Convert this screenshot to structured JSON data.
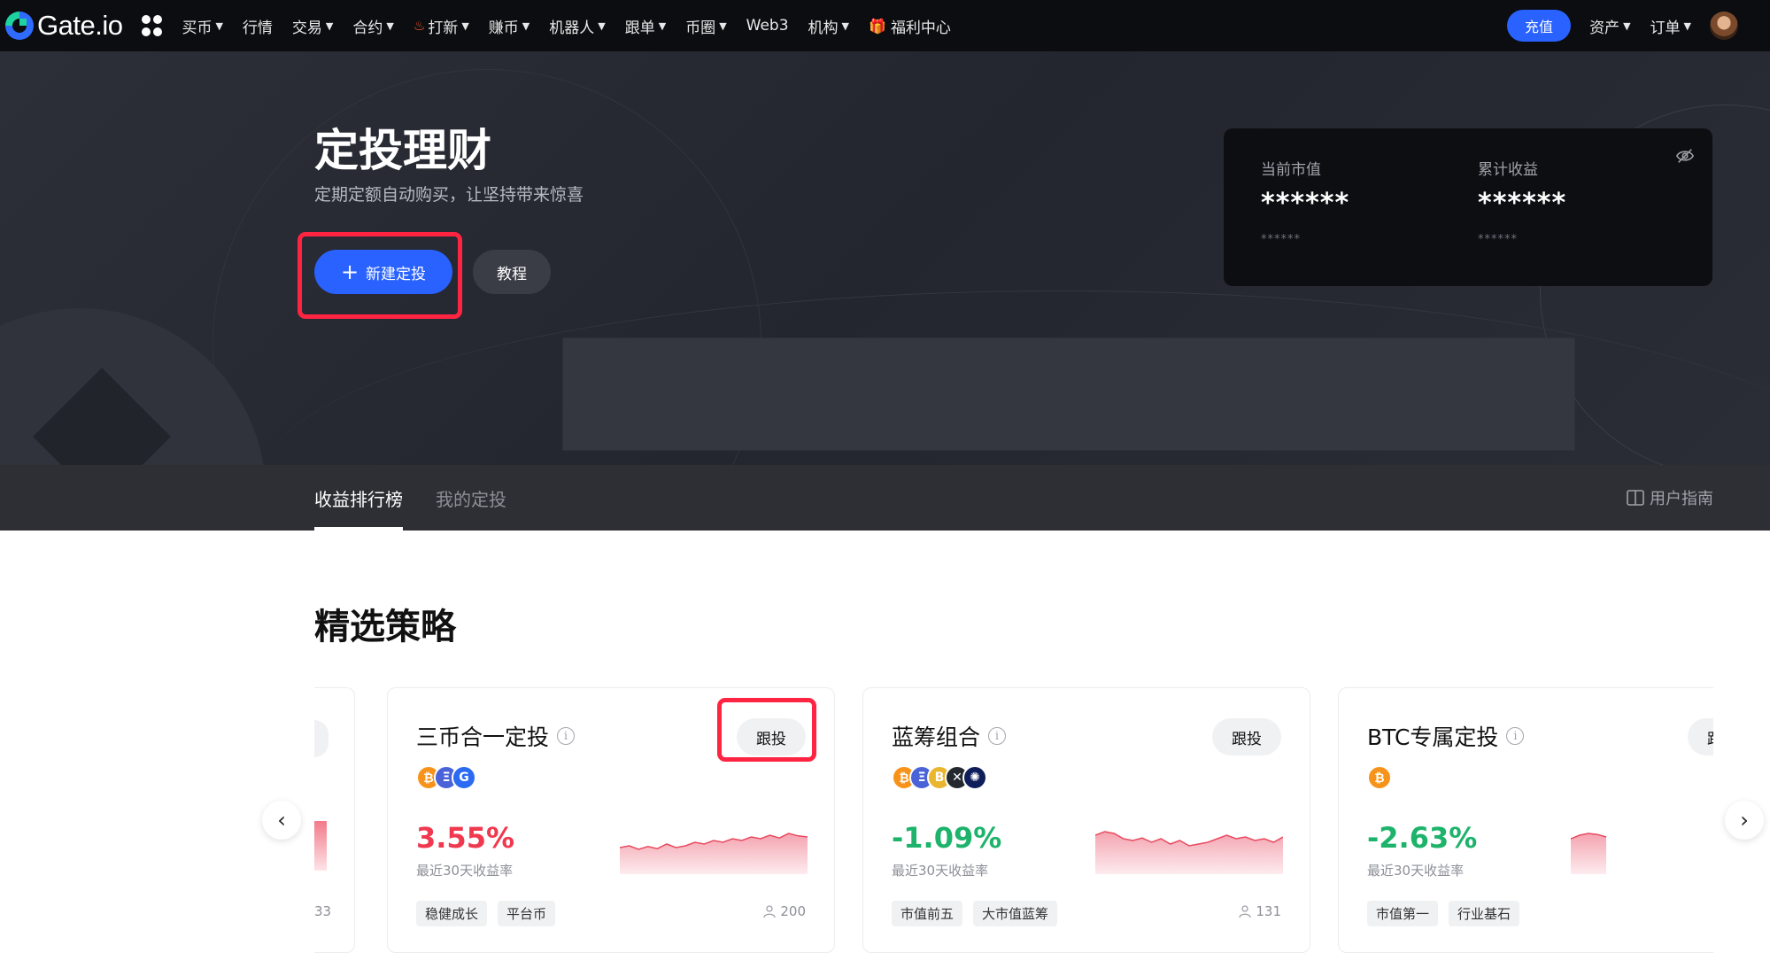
{
  "nav": {
    "brand": "Gate.io",
    "items": [
      {
        "label": "买币",
        "caret": true
      },
      {
        "label": "行情",
        "caret": false
      },
      {
        "label": "交易",
        "caret": true
      },
      {
        "label": "合约",
        "caret": true
      },
      {
        "label": "打新",
        "caret": true,
        "icon": "fire-icon"
      },
      {
        "label": "赚币",
        "caret": true
      },
      {
        "label": "机器人",
        "caret": true
      },
      {
        "label": "跟单",
        "caret": true
      },
      {
        "label": "币圈",
        "caret": true
      },
      {
        "label": "Web3",
        "caret": false
      },
      {
        "label": "机构",
        "caret": true
      },
      {
        "label": "福利中心",
        "caret": false,
        "icon": "gift-icon"
      }
    ],
    "deposit": "充值",
    "assets": "资产",
    "orders": "订单"
  },
  "hero": {
    "title": "定投理财",
    "subtitle": "定期定额自动购买，让坚持带来惊喜",
    "new_button": "新建定投",
    "tutorial_button": "教程",
    "asset_card": {
      "market_value_label": "当前市值",
      "market_value": "******",
      "market_value_sub": "******",
      "total_profit_label": "累计收益",
      "total_profit": "******",
      "total_profit_sub": "******"
    }
  },
  "tabs": {
    "ranking": "收益排行榜",
    "mine": "我的定投",
    "guide": "用户指南"
  },
  "section": {
    "title": "精选策略"
  },
  "left_stub": {
    "followers": "33"
  },
  "cards": [
    {
      "title": "三币合一定投",
      "follow": "跟投",
      "coins": [
        "btc",
        "eth",
        "gt"
      ],
      "yield": "3.55%",
      "yield_color": "#f0384e",
      "yield_label": "最近30天收益率",
      "tags": [
        "稳健成长",
        "平台币"
      ],
      "followers": "200",
      "spark": [
        0.55,
        0.5,
        0.6,
        0.52,
        0.58,
        0.45,
        0.55,
        0.5,
        0.4,
        0.45,
        0.35,
        0.4,
        0.3,
        0.35,
        0.25,
        0.3,
        0.2,
        0.28,
        0.15,
        0.22,
        0.25
      ]
    },
    {
      "title": "蓝筹组合",
      "follow": "跟投",
      "coins": [
        "btc",
        "eth",
        "bnb",
        "xrp",
        "ada"
      ],
      "yield": "-1.09%",
      "yield_color": "#1db36b",
      "yield_label": "最近30天收益率",
      "tags": [
        "市值前五",
        "大市值蓝筹"
      ],
      "followers": "131",
      "spark": [
        0.2,
        0.1,
        0.15,
        0.3,
        0.35,
        0.28,
        0.4,
        0.3,
        0.45,
        0.35,
        0.5,
        0.45,
        0.4,
        0.3,
        0.2,
        0.3,
        0.25,
        0.35,
        0.3,
        0.4,
        0.25
      ]
    },
    {
      "title": "BTC专属定投",
      "follow": "跟投",
      "coins": [
        "btc"
      ],
      "yield": "-2.63%",
      "yield_color": "#1db36b",
      "yield_label": "最近30天收益率",
      "tags": [
        "市值第一",
        "行业基石"
      ],
      "followers": "",
      "spark": [
        0.3,
        0.2,
        0.15,
        0.18,
        0.25
      ]
    }
  ]
}
